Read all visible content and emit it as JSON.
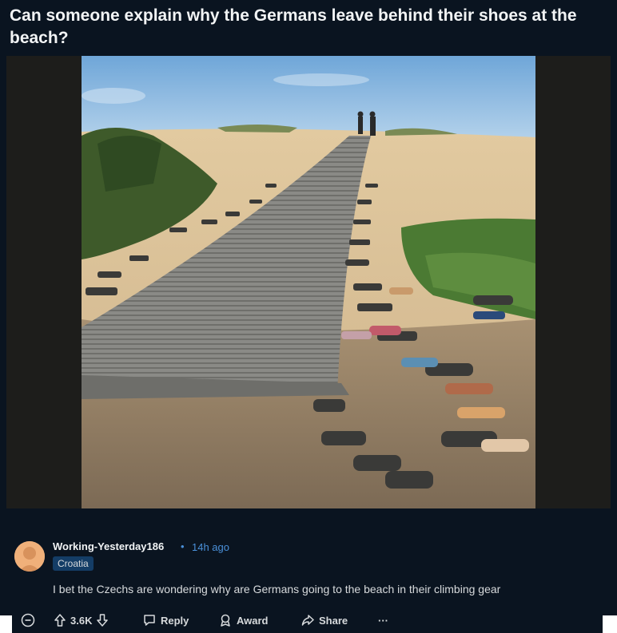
{
  "post": {
    "title": "Can someone explain why the Germans leave behind their shoes at the beach?"
  },
  "comment": {
    "username": "Working-Yesterday186",
    "separator": "•",
    "timestamp": "14h ago",
    "flair": "Croatia",
    "body": "I bet the Czechs are wondering why are Germans going to the beach in their climbing gear"
  },
  "actions": {
    "vote_count": "3.6K",
    "reply_label": "Reply",
    "award_label": "Award",
    "share_label": "Share",
    "more_label": "···"
  },
  "icons": {
    "collapse": "collapse-icon",
    "upvote": "upvote-icon",
    "downvote": "downvote-icon",
    "reply": "comment-bubble-icon",
    "award": "award-icon",
    "share": "share-arrow-icon"
  },
  "colors": {
    "background": "#0a1420",
    "link_blue": "#4a90d9",
    "flair_bg": "#143d66"
  }
}
